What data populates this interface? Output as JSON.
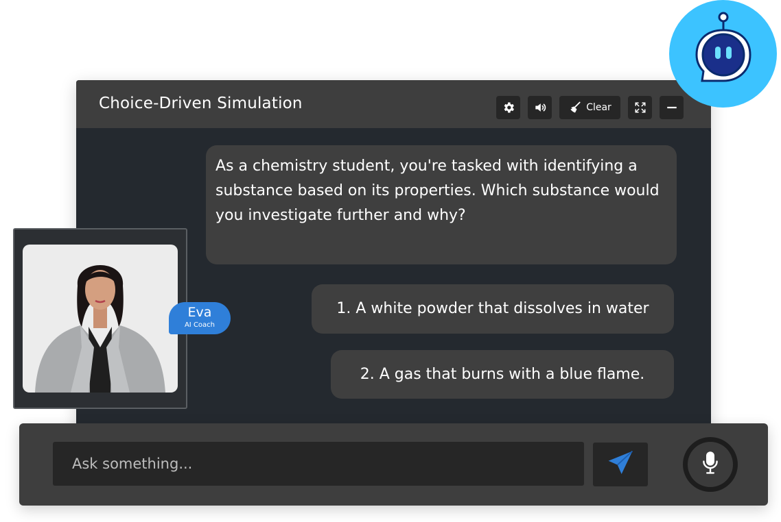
{
  "header": {
    "title": "Choice-Driven Simulation",
    "clear_label": "Clear"
  },
  "chat": {
    "question": "As a chemistry student, you're tasked with identifying a substance based on its properties. Which substance would you investigate further and why?",
    "choices": [
      "1. A white powder that dissolves in water",
      "2. A gas that burns with a blue flame."
    ]
  },
  "coach": {
    "name": "Eva",
    "role": "AI Coach"
  },
  "input": {
    "placeholder": "Ask something..."
  },
  "colors": {
    "accent": "#2f7fd9",
    "bot_bg": "#3cc3ff",
    "window_bg": "#24292f",
    "bubble_bg": "#3f3f3f"
  },
  "icons": [
    "gear-icon",
    "speaker-icon",
    "broom-icon",
    "expand-icon",
    "minimize-icon",
    "send-icon",
    "microphone-icon",
    "robot-icon"
  ]
}
